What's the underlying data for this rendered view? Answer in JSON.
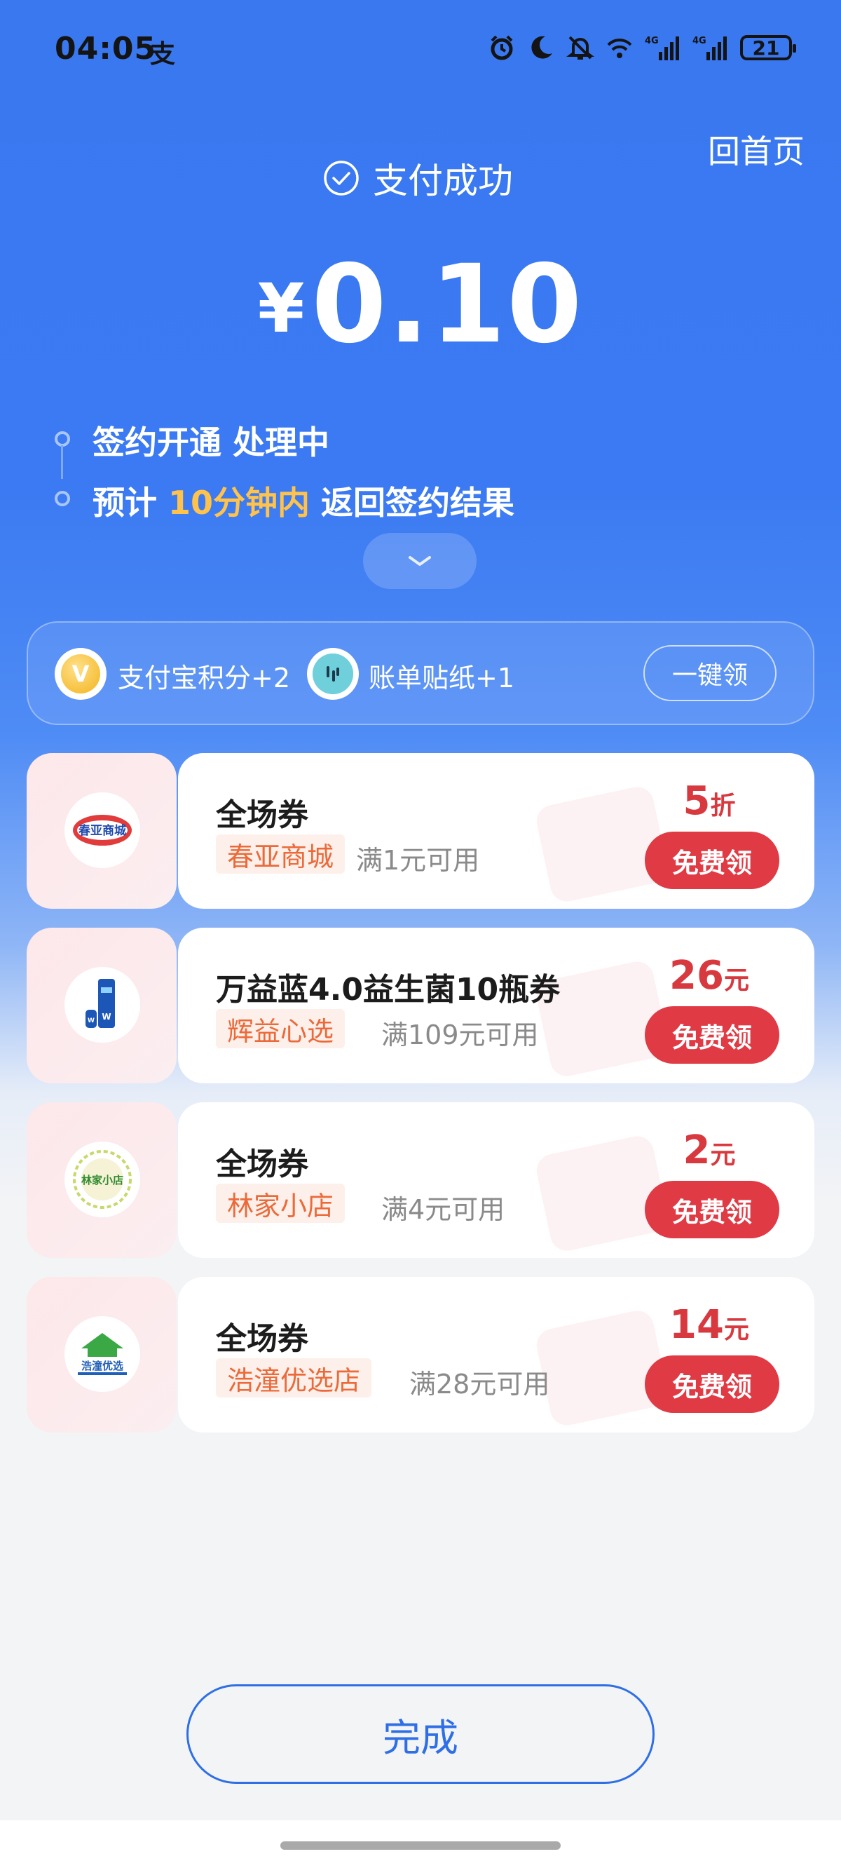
{
  "status_bar": {
    "time": "04:05",
    "alipay_icon": "支",
    "battery": "21",
    "icons": [
      "alarm-icon",
      "moon-icon",
      "mute-icon",
      "wifi-icon",
      "signal-4g-icon",
      "signal-4g-icon",
      "battery-icon"
    ]
  },
  "header": {
    "home_link": "回首页",
    "success_text": "支付成功",
    "currency": "¥",
    "amount": "0.10"
  },
  "timeline": {
    "step1": "签约开通 处理中",
    "step2_prefix": "预计 ",
    "step2_highlight": "10分钟内",
    "step2_suffix": " 返回签约结果"
  },
  "rewards": {
    "points_icon_text": "V",
    "points": "支付宝积分+2",
    "sticker": "账单贴纸+1",
    "claim_all": "一键领"
  },
  "coupons": [
    {
      "logo": "春亚商城",
      "title": "全场券",
      "store": "春亚商城",
      "condition": "满1元可用",
      "value": "5",
      "unit": "折",
      "button": "免费领"
    },
    {
      "logo": "辉益心选",
      "title": "万益蓝4.0益生菌10瓶券",
      "store": "辉益心选",
      "condition": "满109元可用",
      "value": "26",
      "unit": "元",
      "button": "免费领"
    },
    {
      "logo": "林家小店",
      "title": "全场券",
      "store": "林家小店",
      "condition": "满4元可用",
      "value": "2",
      "unit": "元",
      "button": "免费领"
    },
    {
      "logo": "浩潼优选",
      "title": "全场券",
      "store": "浩潼优选店",
      "condition": "满28元可用",
      "value": "14",
      "unit": "元",
      "button": "免费领"
    }
  ],
  "footer": {
    "done": "完成"
  },
  "colors": {
    "primary_blue": "#3a78f0",
    "highlight_yellow": "#ffc24a",
    "coupon_red": "#e03a44",
    "tag_orange": "#ec6a3a"
  }
}
